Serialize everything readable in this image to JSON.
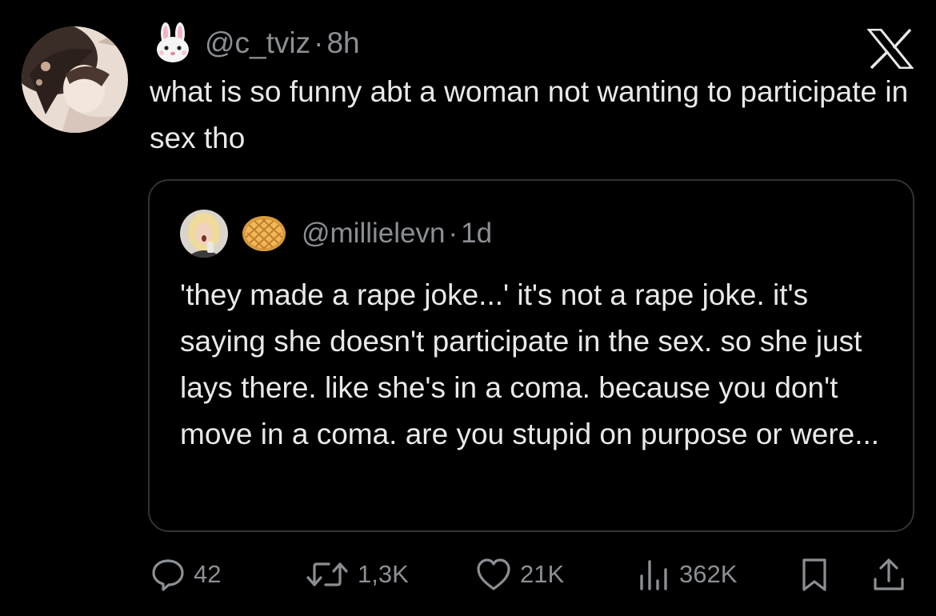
{
  "tweet": {
    "handle": "@c_tviz",
    "separator": "·",
    "time": "8h",
    "text": "what is so funny abt a woman not wanting to participate in sex tho",
    "author_emoji": "rabbit-face"
  },
  "quoted_tweet": {
    "handle": "@millielevn",
    "separator": "·",
    "time": "1d",
    "text": "'they made a rape joke...' it's not a rape joke. it's saying she doesn't participate in the sex. so she just lays there. like she's in a coma. because you don't move in a coma. are you stupid on purpose or were...",
    "author_emoji": "waffle"
  },
  "actions": {
    "replies": "42",
    "reposts": "1,3K",
    "likes": "21K",
    "views": "362K"
  },
  "icons": [
    "rabbit-icon",
    "x-logo-icon",
    "waffle-icon",
    "reply-icon",
    "repost-icon",
    "like-icon",
    "views-icon",
    "bookmark-icon",
    "share-icon"
  ],
  "colors": {
    "background": "#000000",
    "text": "#e7e9ea",
    "muted": "#8b8f94",
    "border": "#2f3336"
  }
}
